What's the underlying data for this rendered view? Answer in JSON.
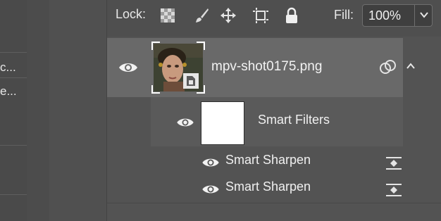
{
  "left_panel": {
    "lines": [
      "c...",
      "e..."
    ]
  },
  "lock_bar": {
    "lock_label": "Lock:",
    "lock_icons": [
      "transparency-checkerboard-icon",
      "brush-icon",
      "move-arrows-icon",
      "crop-artboard-icon",
      "padlock-icon"
    ],
    "fill_label": "Fill:",
    "fill_value": "100%"
  },
  "layer": {
    "name": "mpv-shot0175.png",
    "visible": true,
    "smart_object": true,
    "icons": [
      "eye-icon",
      "smart-object-badge-icon",
      "link-circles-icon",
      "chevron-up-icon"
    ]
  },
  "smart_filters": {
    "label": "Smart Filters",
    "items": [
      {
        "name": "Smart Sharpen"
      },
      {
        "name": "Smart Sharpen"
      }
    ]
  },
  "colors": {
    "panel_bg": "#535353",
    "selected_row": "#696969",
    "text": "#f0f0f0"
  }
}
